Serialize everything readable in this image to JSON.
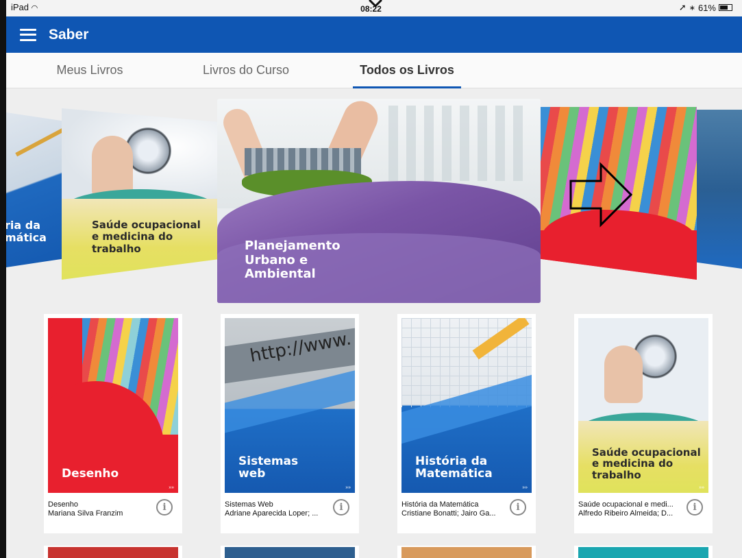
{
  "status": {
    "device": "iPad",
    "time": "08:22",
    "battery": "61%"
  },
  "app": {
    "title": "Saber"
  },
  "tabs": [
    {
      "label": "Meus Livros"
    },
    {
      "label": "Livros do Curso"
    },
    {
      "label": "Todos os Livros"
    }
  ],
  "carousel": {
    "left_partial": "ria da\nmática",
    "left": "Saúde ocupacional\ne medicina do\ntrabalho",
    "center": "Planejamento\nUrbano e\nAmbiental"
  },
  "books": [
    {
      "cover_title": "Desenho",
      "title": "Desenho",
      "authors": "Mariana Silva Franzim"
    },
    {
      "cover_title": "Sistemas\nweb",
      "title": "Sistemas Web",
      "authors": "Adriane Aparecida Loper; ...",
      "url_text": "http://www."
    },
    {
      "cover_title": "História da\nMatemática",
      "title": "História da Matemática",
      "authors": "Cristiane Bonatti; Jairo Ga..."
    },
    {
      "cover_title": "Saúde ocupacional\ne medicina do\ntrabalho",
      "title": "Saúde ocupacional e medi...",
      "authors": "Alfredo Ribeiro Almeida; D..."
    }
  ],
  "cover_marker": "»»",
  "icons": {
    "menu": "hamburger-icon",
    "info": "info-icon",
    "next": "arrow-right-icon",
    "wifi": "wifi-icon",
    "bluetooth": "bluetooth-icon",
    "location": "location-arrow-icon"
  },
  "colors": {
    "primary": "#0f56b3",
    "red": "#e8202e",
    "purple": "#7e5aa8",
    "yellow": "#e3dc55"
  }
}
